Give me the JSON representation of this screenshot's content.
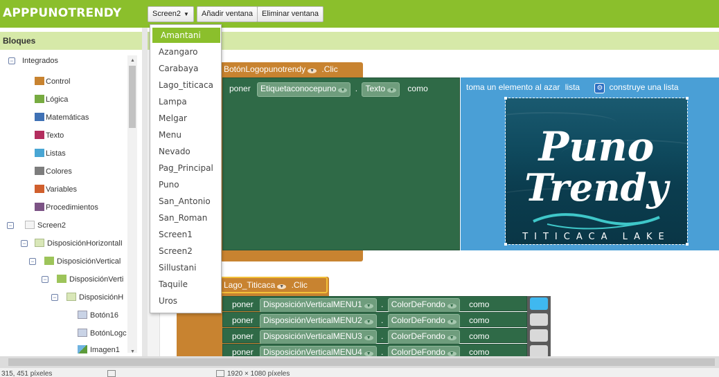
{
  "app": {
    "title": "APPPUNOTRENDY"
  },
  "toolbar": {
    "screen_selector": "Screen2",
    "add_window": "Añadir ventana",
    "remove_window": "Eliminar ventana"
  },
  "screen_menu": {
    "selected": "Amantani",
    "items": [
      "Amantani",
      "Azangaro",
      "Carabaya",
      "Lago_titicaca",
      "Lampa",
      "Melgar",
      "Menu",
      "Nevado",
      "Pag_Principal",
      "Puno",
      "San_Antonio",
      "San_Roman",
      "Screen1",
      "Screen2",
      "Sillustani",
      "Taquile",
      "Uros"
    ]
  },
  "blocks_panel": {
    "title": "Bloques",
    "tree": [
      {
        "label": "Integrados",
        "toggle": "−"
      },
      {
        "label": "Control",
        "color": "#c88330"
      },
      {
        "label": "Lógica",
        "color": "#77ab41"
      },
      {
        "label": "Matemáticas",
        "color": "#3f71b5"
      },
      {
        "label": "Texto",
        "color": "#b32d5e"
      },
      {
        "label": "Listas",
        "color": "#49a6d4"
      },
      {
        "label": "Colores",
        "color": "#7d7d7d"
      },
      {
        "label": "Variables",
        "color": "#d05f2d"
      },
      {
        "label": "Procedimientos",
        "color": "#7c5385"
      },
      {
        "label": "Screen2",
        "toggle": "−"
      },
      {
        "label": "DisposiciónHorizontalI",
        "toggle": "−"
      },
      {
        "label": "DisposiciónVertical",
        "toggle": "−"
      },
      {
        "label": "DisposiciónVerti",
        "toggle": "−"
      },
      {
        "label": "DisposiciónH",
        "toggle": "−"
      },
      {
        "label": "Botón16"
      },
      {
        "label": "BotónLogc"
      },
      {
        "label": "Imagen1"
      }
    ]
  },
  "workspace": {
    "event1": {
      "component": "BotónLogopunotrendy",
      "event": ".Clic",
      "set_word": "poner",
      "target": "Etiquetaconocepuno",
      "dot": ".",
      "property": "Texto",
      "as_word": "como",
      "random_item": "toma un elemento al azar",
      "list_word": "lista",
      "make_list": "construye una lista"
    },
    "event2": {
      "component": "Lago_Titicaca",
      "event": ".Clic",
      "rows": [
        {
          "set_word": "poner",
          "target": "DisposiciónVerticalMENU1",
          "dot": ".",
          "property": "ColorDeFondo",
          "as_word": "como",
          "color": "#3fb8f0"
        },
        {
          "set_word": "poner",
          "target": "DisposiciónVerticalMENU2",
          "dot": ".",
          "property": "ColorDeFondo",
          "as_word": "como",
          "color": "#d9d9d9"
        },
        {
          "set_word": "poner",
          "target": "DisposiciónVerticalMENU3",
          "dot": ".",
          "property": "ColorDeFondo",
          "as_word": "como",
          "color": "#d9d9d9"
        },
        {
          "set_word": "poner",
          "target": "DisposiciónVerticalMENU4",
          "dot": ".",
          "property": "ColorDeFondo",
          "as_word": "como",
          "color": "#d9d9d9"
        }
      ]
    },
    "image": {
      "line1": "Puno",
      "line2": "Trendy",
      "caption": "TITICACA LAKE"
    }
  },
  "status": {
    "cursor": "315, 451 píxeles",
    "size": "1920 × 1080 píxeles"
  }
}
